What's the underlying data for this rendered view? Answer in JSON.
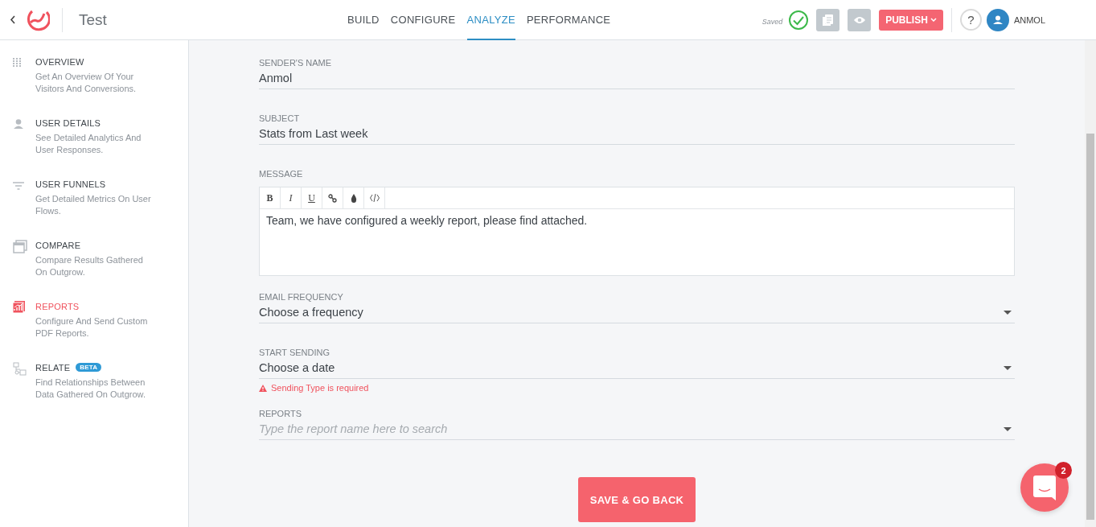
{
  "header": {
    "title": "Test",
    "tabs": [
      {
        "label": "BUILD",
        "selected": false
      },
      {
        "label": "CONFIGURE",
        "selected": false
      },
      {
        "label": "ANALYZE",
        "selected": true
      },
      {
        "label": "PERFORMANCE",
        "selected": false
      }
    ],
    "save_status": "Saved",
    "publish_button": "PUBLISH",
    "help": "?",
    "user": "ANMOL"
  },
  "sidebar": {
    "items": [
      {
        "title": "OVERVIEW",
        "description": "Get An Overview Of Your Visitors And Conversions.",
        "selected": false
      },
      {
        "title": "USER DETAILS",
        "description": "See Detailed Analytics And User Responses.",
        "selected": false
      },
      {
        "title": "USER FUNNELS",
        "description": "Get Detailed Metrics On User Flows.",
        "selected": false
      },
      {
        "title": "COMPARE",
        "description": "Compare Results Gathered On Outgrow.",
        "selected": false
      },
      {
        "title": "REPORTS",
        "description": "Configure And Send Custom PDF Reports.",
        "selected": true
      },
      {
        "title": "RELATE",
        "badge": "BETA",
        "description": "Find Relationships Between Data Gathered On Outgrow.",
        "selected": false
      }
    ]
  },
  "form": {
    "fields": [
      {
        "kind": "text",
        "label": "SENDER'S NAME",
        "value": "Anmol"
      },
      {
        "kind": "text",
        "label": "SUBJECT",
        "value": "Stats from Last week"
      },
      {
        "kind": "editor",
        "label": "MESSAGE",
        "toolbar": [
          "B",
          "I",
          "U"
        ],
        "value": "Team, we have configured a weekly report, please find attached."
      },
      {
        "kind": "select",
        "label": "EMAIL FREQUENCY",
        "value": "Choose a frequency"
      },
      {
        "kind": "select",
        "label": "START SENDING",
        "value": "Choose a date",
        "error": "Sending Type is required"
      },
      {
        "kind": "select",
        "label": "REPORTS",
        "placeholder": "Type the report name here to search"
      }
    ],
    "save_button": "SAVE & GO BACK"
  },
  "chat": {
    "badge": "2"
  }
}
